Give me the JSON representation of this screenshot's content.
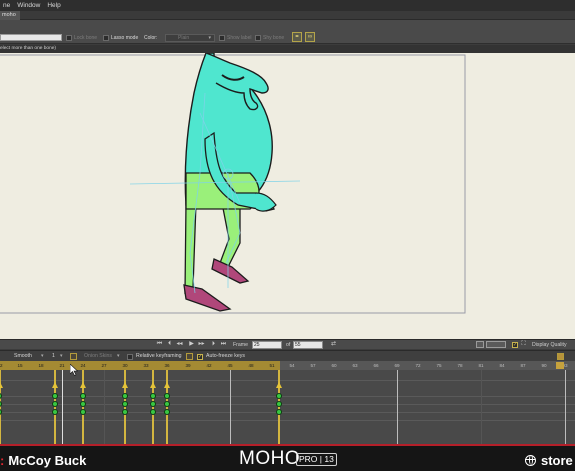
{
  "menubar": {
    "items": [
      "ne",
      "Window",
      "Help"
    ]
  },
  "tabs": {
    "doc": "moho"
  },
  "toolbar": {
    "lock_bone": "Lock bone",
    "lasso_mode": "Lasso mode",
    "color_label": "Color:",
    "color_value": "Plain",
    "show_label": "Show label",
    "shy_bone": "Shy bone"
  },
  "status": {
    "text": "elect more than one bone)"
  },
  "playback": {
    "frame_label": "Frame",
    "frame_value": "25",
    "of_label": "of",
    "total_frames": "55",
    "display_quality": "Display Quality"
  },
  "timeline_toolbar": {
    "interpolation": "Smooth",
    "step": "1",
    "onion_skins": "Onion Skins",
    "relative_keyframing": "Relative keyframing",
    "auto_freeze_keys": "Auto-freeze keys"
  },
  "ruler": {
    "ticks": [
      "12",
      "15",
      "18",
      "21",
      "24",
      "27",
      "30",
      "33",
      "36",
      "39",
      "42",
      "45",
      "48",
      "51",
      "54",
      "57",
      "60",
      "63",
      "66",
      "69",
      "72",
      "75",
      "78",
      "81",
      "84",
      "87",
      "90",
      "93",
      "96"
    ]
  },
  "banner": {
    "author_prefix": ":",
    "author": "McCoy Buck",
    "product": "MOHO",
    "edition": "PRO | 13",
    "store": "store"
  },
  "colors": {
    "canvas": "#efede1",
    "character_body": "#4fe6cf",
    "character_legs": "#9af07a",
    "shoes": "#b0477a",
    "keyframe": "#39c643",
    "key_line": "#d3b640",
    "banner_accent": "#e02630"
  }
}
